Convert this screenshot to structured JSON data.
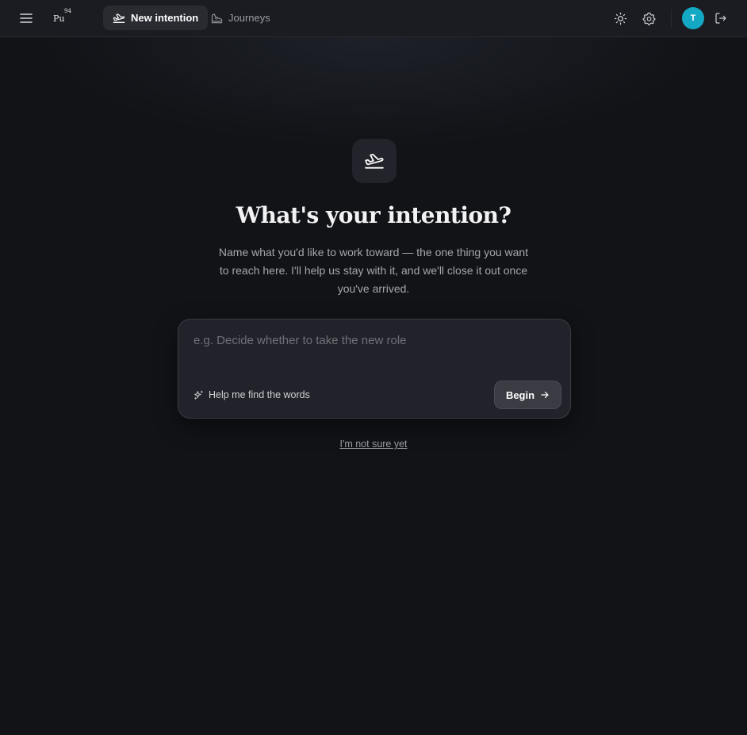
{
  "app": {
    "logo_symbol": "Pu",
    "logo_number": "94"
  },
  "nav": {
    "tabs": [
      {
        "label": "New intention",
        "icon": "plane-takeoff-icon",
        "active": true
      },
      {
        "label": "Journeys",
        "icon": "shoe-icon",
        "active": false
      }
    ]
  },
  "header": {
    "avatar_initial": "T",
    "avatar_color": "#13a9c5",
    "icons": [
      "menu-icon",
      "sun-icon",
      "gear-icon",
      "logout-icon"
    ]
  },
  "main": {
    "hero_icon": "plane-takeoff-icon",
    "title": "What's your intention?",
    "subtitle": "Name what you'd like to work toward — the one thing you want to reach here. I'll help us stay with it, and we'll close it out once you've arrived.",
    "input_placeholder": "e.g. Decide whether to take the new role",
    "input_value": "",
    "help_label": "Help me find the words",
    "begin_label": "Begin",
    "not_sure_label": "I'm not sure yet"
  },
  "colors": {
    "background": "#121317",
    "topbar": "#1b1c21",
    "card": "#22232a",
    "accent": "#13a9c5"
  }
}
